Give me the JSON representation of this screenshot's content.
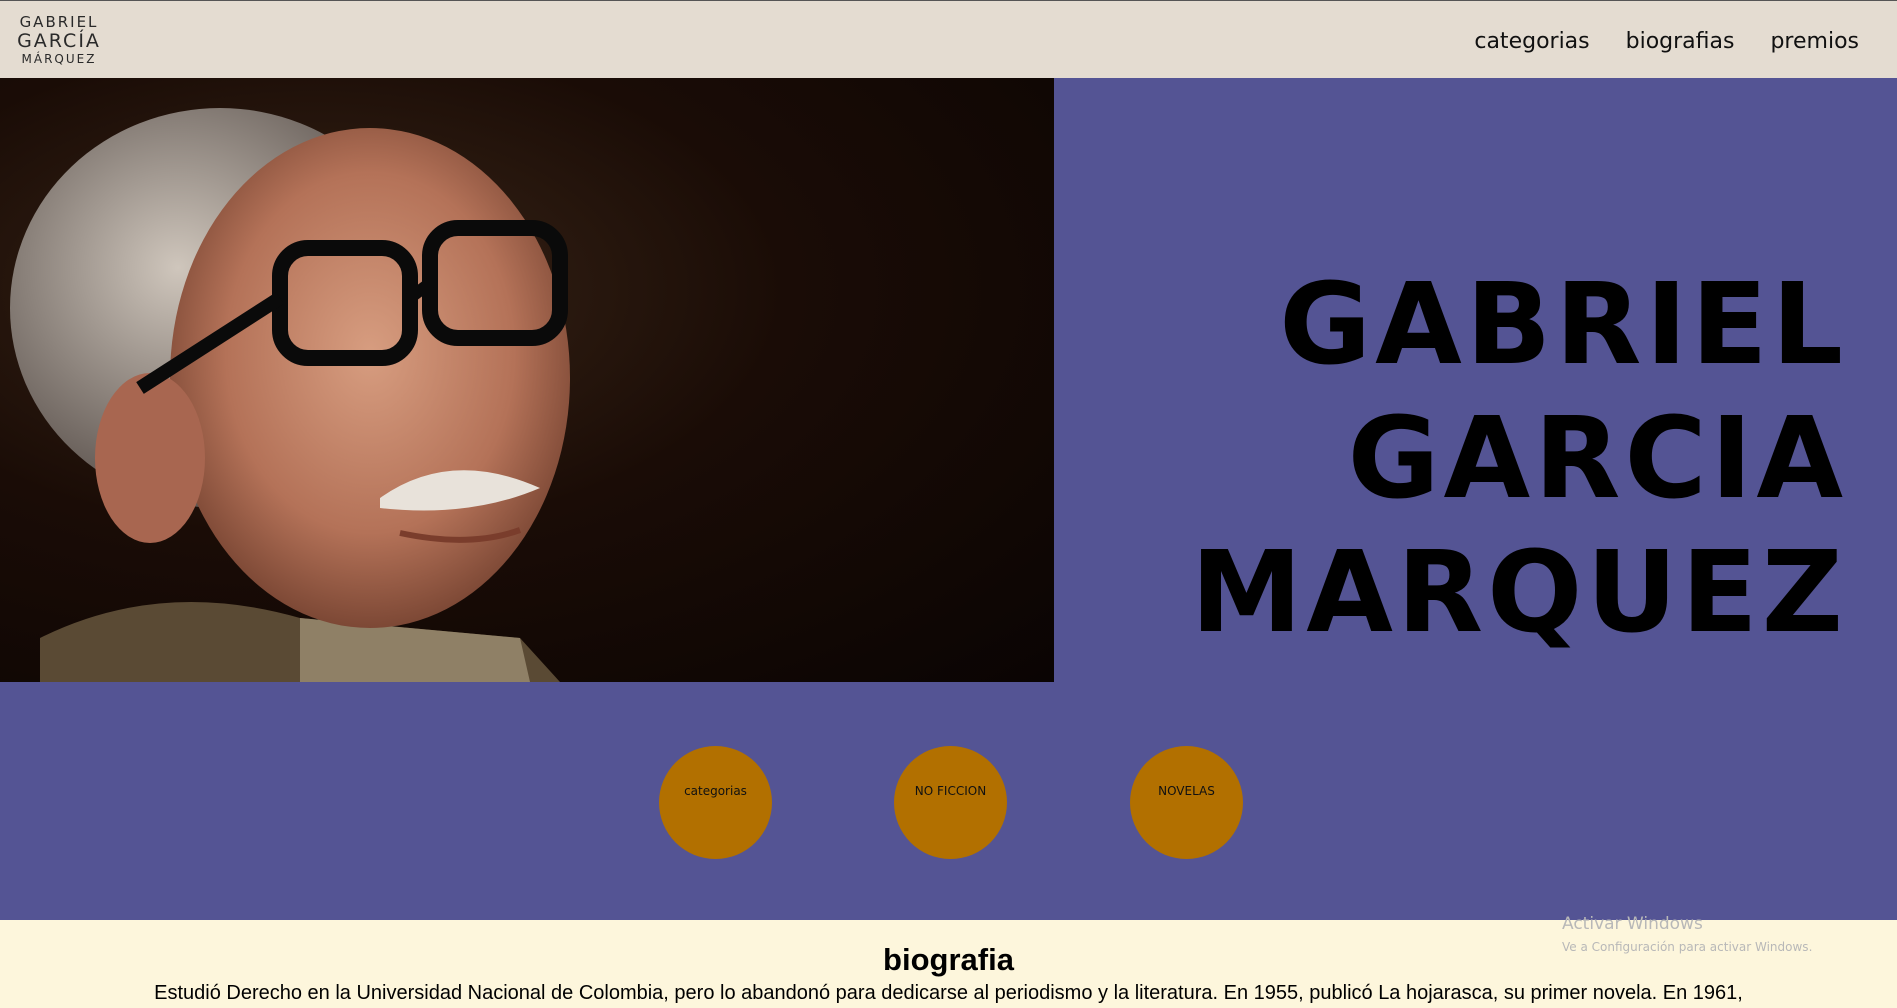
{
  "header": {
    "logo": {
      "line1": "GABRIEL",
      "line2": "GARCÍA",
      "line3": "MÁRQUEZ"
    },
    "nav": [
      {
        "label": "categorias"
      },
      {
        "label": "biografias"
      },
      {
        "label": "premios"
      }
    ]
  },
  "hero": {
    "photo_icon": "portrait-photo",
    "title_lines": [
      "GABRIEL",
      "GARCIA",
      "MARQUEZ"
    ],
    "circles": [
      {
        "label": "categorias"
      },
      {
        "label": "NO FICCION"
      },
      {
        "label": "NOVELAS"
      }
    ]
  },
  "bio": {
    "heading": "biografia",
    "text": "Estudió Derecho en la Universidad Nacional de Colombia, pero lo abandonó para dedicarse al periodismo y la literatura. En 1955, publicó La hojarasca, su primer novela. En 1961,"
  },
  "watermark": {
    "line1": "Activar Windows",
    "line2": "Ve a Configuración para activar Windows."
  },
  "colors": {
    "header_bg": "#e4dcd1",
    "hero_bg": "#545494",
    "circle": "#b27000",
    "bio_bg": "#fdf6dc"
  }
}
